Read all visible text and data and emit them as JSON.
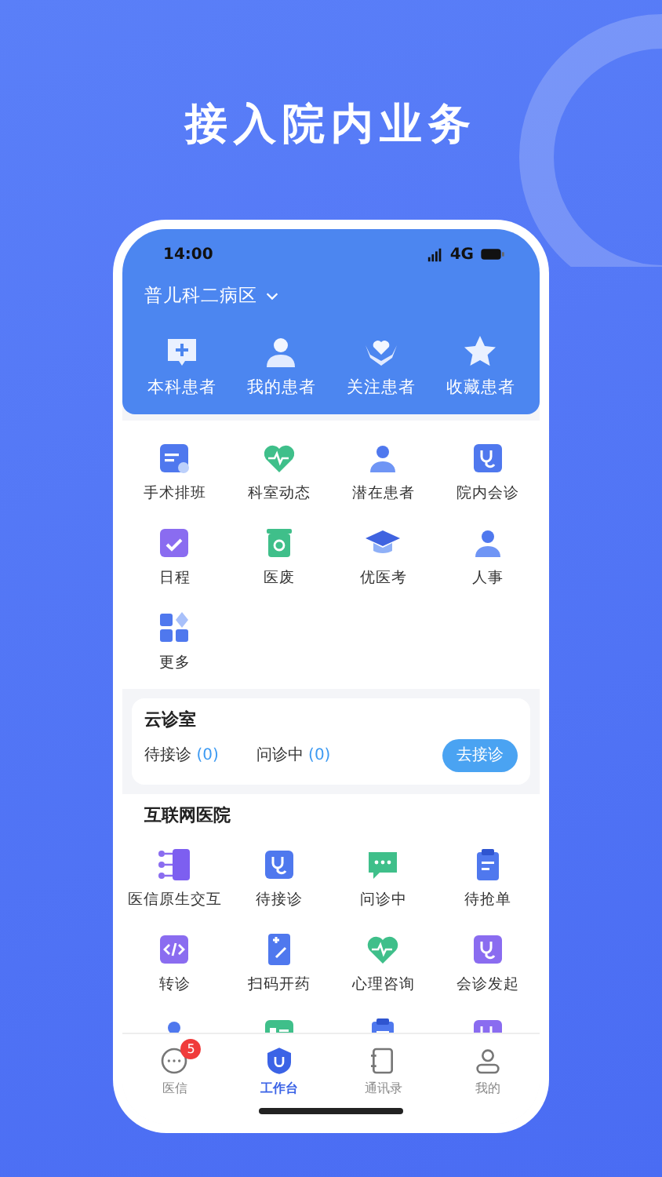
{
  "headline": "接入院内业务",
  "status_bar": {
    "time": "14:00",
    "network": "4G"
  },
  "ward": {
    "name": "普儿科二病区"
  },
  "patient_tabs": [
    {
      "label": "本科患者"
    },
    {
      "label": "我的患者"
    },
    {
      "label": "关注患者"
    },
    {
      "label": "收藏患者"
    }
  ],
  "tools": [
    {
      "label": "手术排班"
    },
    {
      "label": "科室动态"
    },
    {
      "label": "潜在患者"
    },
    {
      "label": "院内会诊"
    },
    {
      "label": "日程"
    },
    {
      "label": "医废"
    },
    {
      "label": "优医考"
    },
    {
      "label": "人事"
    },
    {
      "label": "更多"
    }
  ],
  "cloud_clinic": {
    "title": "云诊室",
    "counts": [
      {
        "label": "待接诊",
        "value": "(0)"
      },
      {
        "label": "问诊中",
        "value": "(0)"
      }
    ],
    "button": "去接诊"
  },
  "internet_hospital": {
    "title": "互联网医院",
    "items": [
      {
        "label": "医信原生交互"
      },
      {
        "label": "待接诊"
      },
      {
        "label": "问诊中"
      },
      {
        "label": "待抢单"
      },
      {
        "label": "转诊"
      },
      {
        "label": "扫码开药"
      },
      {
        "label": "心理咨询"
      },
      {
        "label": "会诊发起"
      }
    ]
  },
  "tab_bar": [
    {
      "label": "医信",
      "selected": false,
      "badge": "5"
    },
    {
      "label": "工作台",
      "selected": true
    },
    {
      "label": "通讯录",
      "selected": false
    },
    {
      "label": "我的",
      "selected": false
    }
  ]
}
